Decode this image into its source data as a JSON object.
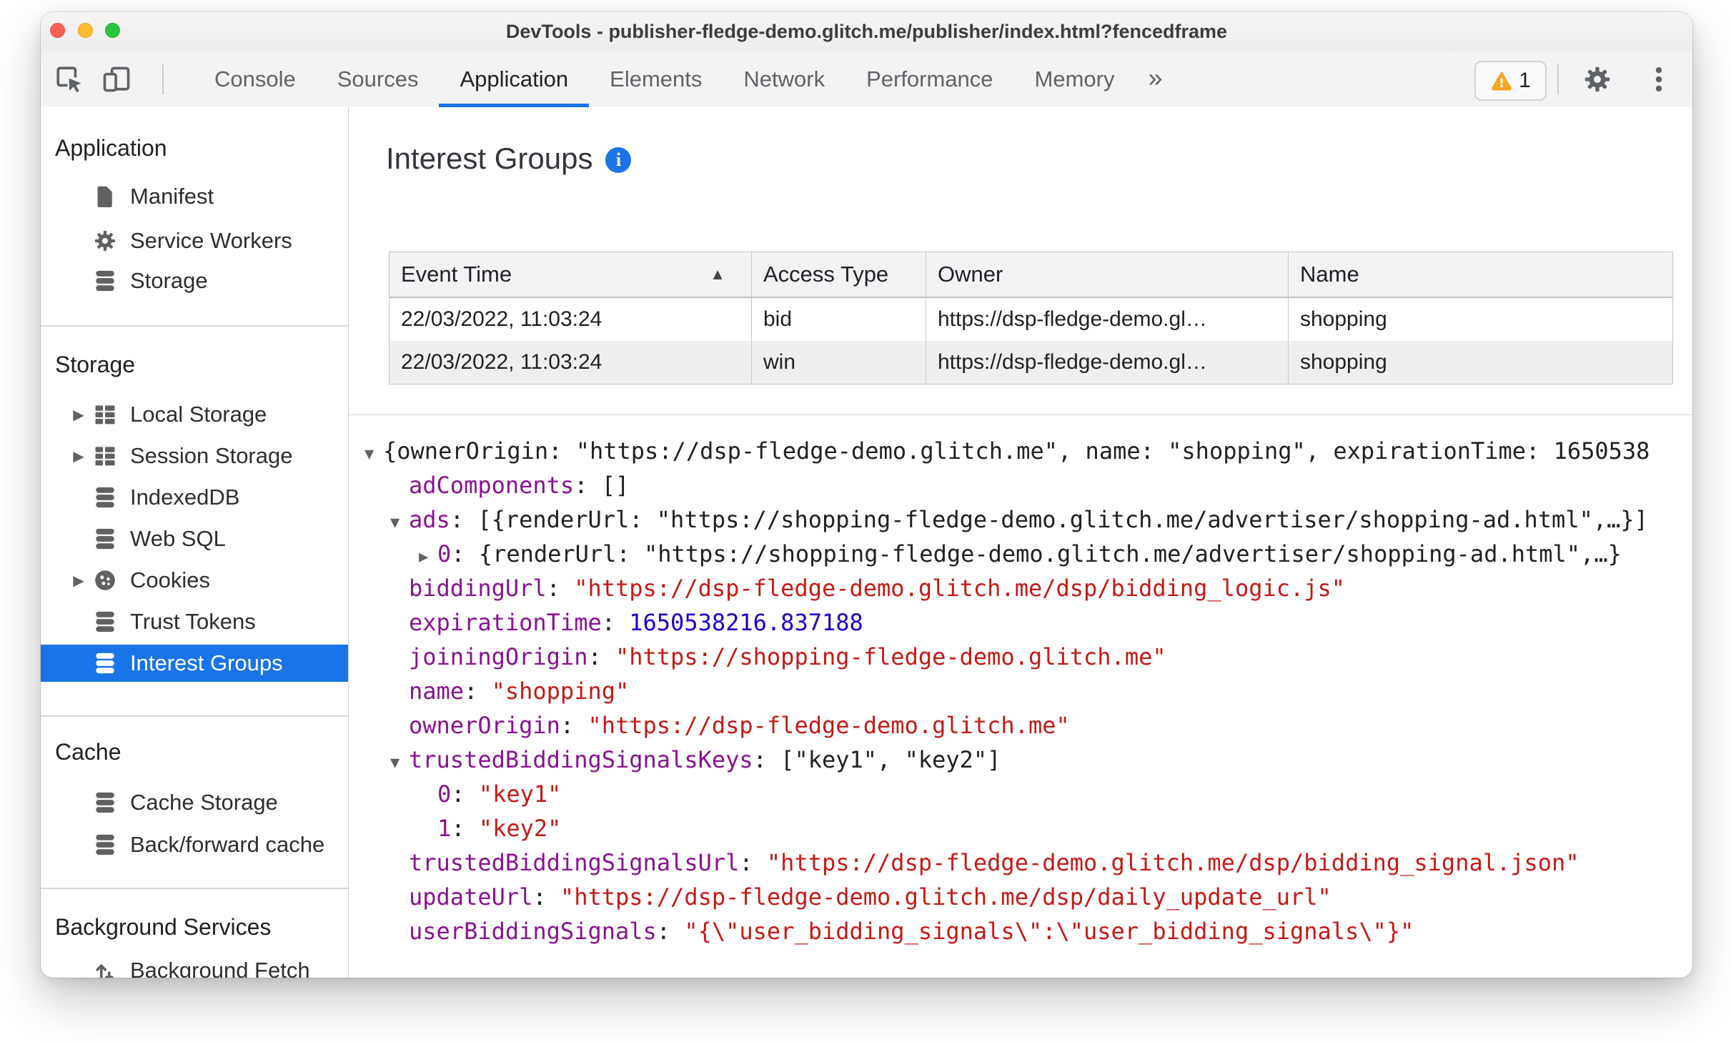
{
  "window": {
    "title": "DevTools - publisher-fledge-demo.glitch.me/publisher/index.html?fencedframe"
  },
  "toolbar": {
    "tabs": [
      {
        "label": "Console",
        "selected": false
      },
      {
        "label": "Sources",
        "selected": false
      },
      {
        "label": "Application",
        "selected": true
      },
      {
        "label": "Elements",
        "selected": false
      },
      {
        "label": "Network",
        "selected": false
      },
      {
        "label": "Performance",
        "selected": false
      },
      {
        "label": "Memory",
        "selected": false
      }
    ],
    "more_tabs_symbol": "»",
    "warning_badge_count": "1"
  },
  "sidebar": {
    "sections": [
      {
        "title": "Application",
        "items": [
          {
            "label": "Manifest",
            "icon": "document",
            "expandable": false,
            "selected": false
          },
          {
            "label": "Service Workers",
            "icon": "gear",
            "expandable": false,
            "selected": false
          },
          {
            "label": "Storage",
            "icon": "database",
            "expandable": false,
            "selected": false
          }
        ]
      },
      {
        "title": "Storage",
        "items": [
          {
            "label": "Local Storage",
            "icon": "table",
            "expandable": true,
            "selected": false
          },
          {
            "label": "Session Storage",
            "icon": "table",
            "expandable": true,
            "selected": false
          },
          {
            "label": "IndexedDB",
            "icon": "database",
            "expandable": false,
            "selected": false
          },
          {
            "label": "Web SQL",
            "icon": "database",
            "expandable": false,
            "selected": false
          },
          {
            "label": "Cookies",
            "icon": "cookie",
            "expandable": true,
            "selected": false
          },
          {
            "label": "Trust Tokens",
            "icon": "database",
            "expandable": false,
            "selected": false
          },
          {
            "label": "Interest Groups",
            "icon": "database",
            "expandable": false,
            "selected": true
          }
        ]
      },
      {
        "title": "Cache",
        "items": [
          {
            "label": "Cache Storage",
            "icon": "database",
            "expandable": false,
            "selected": false
          },
          {
            "label": "Back/forward cache",
            "icon": "database",
            "expandable": false,
            "selected": false
          }
        ]
      },
      {
        "title": "Background Services",
        "items": [
          {
            "label": "Background Fetch",
            "icon": "fetch",
            "expandable": false,
            "selected": false
          }
        ]
      }
    ]
  },
  "main": {
    "heading": "Interest Groups",
    "table": {
      "columns": [
        "Event Time",
        "Access Type",
        "Owner",
        "Name"
      ],
      "sorted_column": 0,
      "sort_symbol": "▲",
      "rows": [
        [
          "22/03/2022, 11:03:24",
          "bid",
          "https://dsp-fledge-demo.gl…",
          "shopping"
        ],
        [
          "22/03/2022, 11:03:24",
          "win",
          "https://dsp-fledge-demo.gl…",
          "shopping"
        ]
      ]
    },
    "tree": {
      "lines": [
        {
          "indent": 0,
          "arrow": "down",
          "key": "",
          "value": "{ownerOrigin: \"https://dsp-fledge-demo.glitch.me\", name: \"shopping\", expirationTime: 1650538",
          "type": "plain"
        },
        {
          "indent": 1,
          "arrow": "",
          "key": "adComponents",
          "value": "[]",
          "type": "plain"
        },
        {
          "indent": 1,
          "arrow": "down",
          "key": "ads",
          "value": "[{renderUrl: \"https://shopping-fledge-demo.glitch.me/advertiser/shopping-ad.html\",…}]",
          "type": "plain"
        },
        {
          "indent": 2,
          "arrow": "right",
          "key": "0",
          "value": "{renderUrl: \"https://shopping-fledge-demo.glitch.me/advertiser/shopping-ad.html\",…}",
          "type": "plain"
        },
        {
          "indent": 1,
          "arrow": "",
          "key": "biddingUrl",
          "value": "\"https://dsp-fledge-demo.glitch.me/dsp/bidding_logic.js\"",
          "type": "string"
        },
        {
          "indent": 1,
          "arrow": "",
          "key": "expirationTime",
          "value": "1650538216.837188",
          "type": "number"
        },
        {
          "indent": 1,
          "arrow": "",
          "key": "joiningOrigin",
          "value": "\"https://shopping-fledge-demo.glitch.me\"",
          "type": "string"
        },
        {
          "indent": 1,
          "arrow": "",
          "key": "name",
          "value": "\"shopping\"",
          "type": "string"
        },
        {
          "indent": 1,
          "arrow": "",
          "key": "ownerOrigin",
          "value": "\"https://dsp-fledge-demo.glitch.me\"",
          "type": "string"
        },
        {
          "indent": 1,
          "arrow": "down",
          "key": "trustedBiddingSignalsKeys",
          "value": "[\"key1\", \"key2\"]",
          "type": "plain"
        },
        {
          "indent": 2,
          "arrow": "",
          "key": "0",
          "value": "\"key1\"",
          "type": "string"
        },
        {
          "indent": 2,
          "arrow": "",
          "key": "1",
          "value": "\"key2\"",
          "type": "string"
        },
        {
          "indent": 1,
          "arrow": "",
          "key": "trustedBiddingSignalsUrl",
          "value": "\"https://dsp-fledge-demo.glitch.me/dsp/bidding_signal.json\"",
          "type": "string"
        },
        {
          "indent": 1,
          "arrow": "",
          "key": "updateUrl",
          "value": "\"https://dsp-fledge-demo.glitch.me/dsp/daily_update_url\"",
          "type": "string"
        },
        {
          "indent": 1,
          "arrow": "",
          "key": "userBiddingSignals",
          "value": "\"{\\\"user_bidding_signals\\\":\\\"user_bidding_signals\\\"}\"",
          "type": "string"
        }
      ]
    }
  },
  "colors": {
    "accent_blue": "#1a73e8",
    "key_purple": "#881391",
    "string_red": "#c41a16",
    "number_blue": "#1c00cf",
    "warning_amber": "#f5a623",
    "traffic_red": "#ff5f57",
    "traffic_yellow": "#febc2e",
    "traffic_green": "#28c840"
  }
}
